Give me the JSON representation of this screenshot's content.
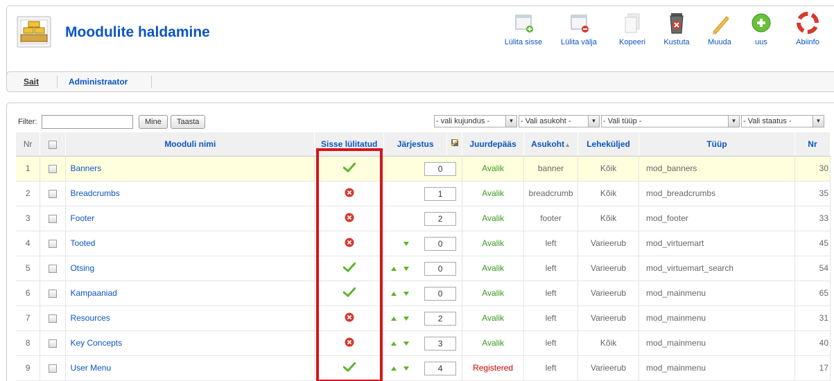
{
  "header": {
    "title": "Moodulite haldamine",
    "toolbar": [
      {
        "label": "Lülita sisse",
        "icon": "publish-icon"
      },
      {
        "label": "Lülita välja",
        "icon": "unpublish-icon"
      },
      {
        "label": "Kopeeri",
        "icon": "copy-icon"
      },
      {
        "label": "Kustuta",
        "icon": "delete-icon"
      },
      {
        "label": "Muuda",
        "icon": "edit-icon"
      },
      {
        "label": "uus",
        "icon": "new-icon"
      },
      {
        "label": "Abiinfo",
        "icon": "help-icon"
      }
    ]
  },
  "submenu": {
    "items": [
      {
        "label": "Sait",
        "active": true
      },
      {
        "label": "Administraator",
        "active": false
      }
    ]
  },
  "filter": {
    "label": "Filter:",
    "value": "",
    "go_label": "Mine",
    "reset_label": "Taasta",
    "selects": [
      "- vali kujundus -",
      "- Vali asukoht -",
      "- Vali tüüp -",
      "- Vali staatus -"
    ]
  },
  "table": {
    "headers": {
      "nr": "Nr",
      "name": "Mooduli nimi",
      "enabled": "Sisse lülitatud",
      "order": "Järjestus",
      "access": "Juurdepääs",
      "position": "Asukoht",
      "pages": "Leheküljed",
      "type": "Tüüp",
      "id": "Nr"
    },
    "rows": [
      {
        "nr": "1",
        "name": "Banners",
        "enabled": true,
        "up": false,
        "down": false,
        "order": "0",
        "access": "Avalik",
        "position": "banner",
        "pages": "Kõik",
        "type": "mod_banners",
        "id": "30"
      },
      {
        "nr": "2",
        "name": "Breadcrumbs",
        "enabled": false,
        "up": false,
        "down": false,
        "order": "1",
        "access": "Avalik",
        "position": "breadcrumb",
        "pages": "Kõik",
        "type": "mod_breadcrumbs",
        "id": "35"
      },
      {
        "nr": "3",
        "name": "Footer",
        "enabled": false,
        "up": false,
        "down": false,
        "order": "2",
        "access": "Avalik",
        "position": "footer",
        "pages": "Kõik",
        "type": "mod_footer",
        "id": "33"
      },
      {
        "nr": "4",
        "name": "Tooted",
        "enabled": false,
        "up": false,
        "down": true,
        "order": "0",
        "access": "Avalik",
        "position": "left",
        "pages": "Varieerub",
        "type": "mod_virtuemart",
        "id": "45"
      },
      {
        "nr": "5",
        "name": "Otsing",
        "enabled": true,
        "up": true,
        "down": true,
        "order": "0",
        "access": "Avalik",
        "position": "left",
        "pages": "Varieerub",
        "type": "mod_virtuemart_search",
        "id": "54"
      },
      {
        "nr": "6",
        "name": "Kampaaniad",
        "enabled": true,
        "up": true,
        "down": true,
        "order": "0",
        "access": "Avalik",
        "position": "left",
        "pages": "Varieerub",
        "type": "mod_mainmenu",
        "id": "65"
      },
      {
        "nr": "7",
        "name": "Resources",
        "enabled": false,
        "up": true,
        "down": true,
        "order": "2",
        "access": "Avalik",
        "position": "left",
        "pages": "Varieerub",
        "type": "mod_mainmenu",
        "id": "31"
      },
      {
        "nr": "8",
        "name": "Key Concepts",
        "enabled": false,
        "up": true,
        "down": true,
        "order": "3",
        "access": "Avalik",
        "position": "left",
        "pages": "Kõik",
        "type": "mod_mainmenu",
        "id": "40"
      },
      {
        "nr": "9",
        "name": "User Menu",
        "enabled": true,
        "up": true,
        "down": true,
        "order": "4",
        "access": "Registered",
        "position": "left",
        "pages": "Varieerub",
        "type": "mod_mainmenu",
        "id": "17"
      }
    ]
  },
  "colors": {
    "link": "#0b55c4",
    "enabled_green": "#5ab52a",
    "disabled_red": "#d63a2c",
    "highlight_border": "#d4161b",
    "access_public": "#3a9a1e",
    "access_registered": "#cc0000"
  }
}
